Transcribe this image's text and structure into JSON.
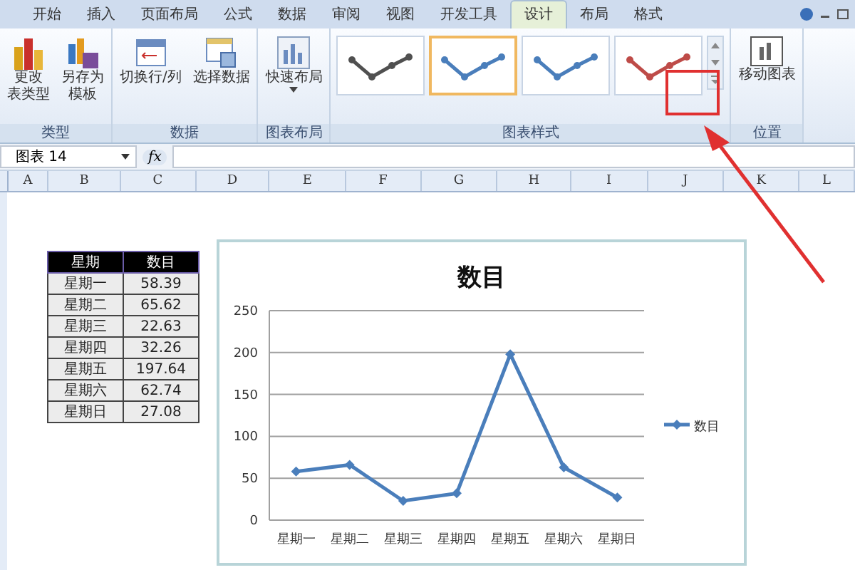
{
  "tabs": [
    {
      "label": "开始",
      "selected": false
    },
    {
      "label": "插入",
      "selected": false
    },
    {
      "label": "页面布局",
      "selected": false
    },
    {
      "label": "公式",
      "selected": false
    },
    {
      "label": "数据",
      "selected": false
    },
    {
      "label": "审阅",
      "selected": false
    },
    {
      "label": "视图",
      "selected": false
    },
    {
      "label": "开发工具",
      "selected": false
    },
    {
      "label": "设计",
      "selected": true
    },
    {
      "label": "布局",
      "selected": false
    },
    {
      "label": "格式",
      "selected": false
    }
  ],
  "groups": [
    {
      "label": "类型",
      "items": [
        {
          "kind": "button",
          "lines": [
            "更改",
            "表类型"
          ]
        },
        {
          "kind": "button",
          "lines": [
            "另存为",
            "模板"
          ]
        }
      ]
    },
    {
      "label": "数据",
      "items": [
        {
          "kind": "button",
          "lines": [
            "切换行/列"
          ]
        },
        {
          "kind": "button",
          "lines": [
            "选择数据"
          ]
        }
      ]
    },
    {
      "label": "图表布局",
      "items": [
        {
          "kind": "button",
          "lines": [
            "快速布局"
          ],
          "dropdown": true
        }
      ]
    },
    {
      "label": "图表样式",
      "items": [
        {
          "kind": "gallery",
          "styles": [
            {
              "color": "#505050",
              "selected": false
            },
            {
              "color": "#4a7ebb",
              "selected": true
            },
            {
              "color": "#4a7ebb",
              "selected": false
            },
            {
              "color": "#be4b48",
              "selected": false
            }
          ]
        }
      ]
    },
    {
      "label": "位置",
      "items": [
        {
          "kind": "button",
          "lines": [
            "移动图表"
          ]
        }
      ]
    }
  ],
  "formula_bar": {
    "name_box": "图表 14",
    "function_label": "fx"
  },
  "columns": [
    "A",
    "B",
    "C",
    "D",
    "E",
    "F",
    "G",
    "H",
    "I",
    "J",
    "K",
    "L"
  ],
  "table": {
    "columns": [
      "星期",
      "数目"
    ],
    "rows": [
      [
        "星期一",
        "58.39"
      ],
      [
        "星期二",
        "65.62"
      ],
      [
        "星期三",
        "22.63"
      ],
      [
        "星期四",
        "32.26"
      ],
      [
        "星期五",
        "197.64"
      ],
      [
        "星期六",
        "62.74"
      ],
      [
        "星期日",
        "27.08"
      ]
    ]
  },
  "chart": {
    "chart_data": {
      "type": "line",
      "title": "数目",
      "categories": [
        "星期一",
        "星期二",
        "星期三",
        "星期四",
        "星期五",
        "星期六",
        "星期日"
      ],
      "series": [
        {
          "name": "数目",
          "color": "#4a7ebb",
          "marker": "diamond",
          "values": [
            58,
            66,
            23,
            32,
            198,
            63,
            27
          ]
        }
      ],
      "ylim": [
        0,
        250
      ],
      "yticks": [
        0,
        50,
        100,
        150,
        200,
        250
      ],
      "grid": true
    }
  }
}
